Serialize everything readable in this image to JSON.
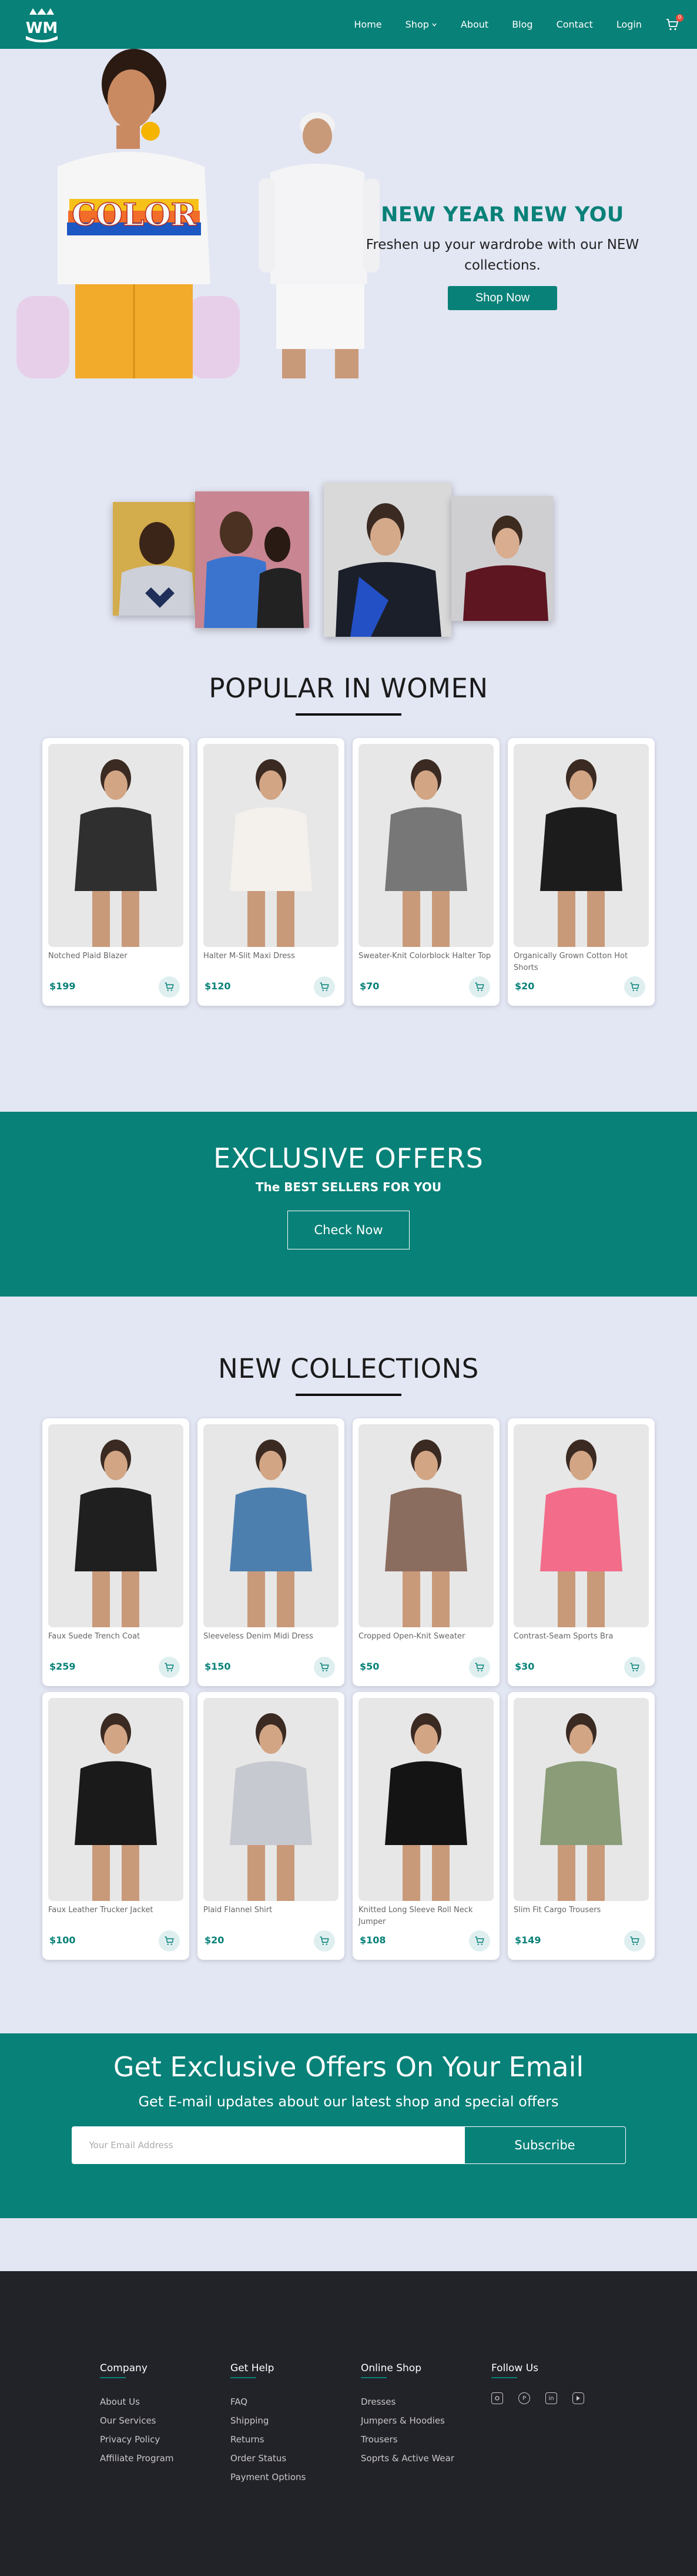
{
  "brand": {
    "logo_text": "WM",
    "accent_color": "#088178",
    "background_color": "#e3e6f3",
    "footer_color": "#222229"
  },
  "nav": {
    "items": [
      {
        "label": "Home"
      },
      {
        "label": "Shop"
      },
      {
        "label": "About"
      },
      {
        "label": "Blog"
      },
      {
        "label": "Contact"
      },
      {
        "label": "Login"
      }
    ],
    "cart_count": "0"
  },
  "hero": {
    "title": "NEW YEAR NEW YOU",
    "subtitle": "Freshen up your wardrobe with our NEW collections.",
    "button": "Shop Now",
    "shirt_text": "COLOR"
  },
  "popular": {
    "title": "POPULAR IN WOMEN",
    "products": [
      {
        "name": "Notched Plaid Blazer",
        "price": "$199",
        "tone": "#2f2f2f"
      },
      {
        "name": "Halter M-Slit Maxi Dress",
        "price": "$120",
        "tone": "#f4f1ec"
      },
      {
        "name": "Sweater-Knit Colorblock Halter Top",
        "price": "$70",
        "tone": "#777777"
      },
      {
        "name": "Organically Grown Cotton Hot Shorts",
        "price": "$20",
        "tone": "#1c1c1c"
      }
    ]
  },
  "offers": {
    "title": "EXCLUSIVE OFFERS",
    "subtitle": "The BEST SELLERS FOR YOU",
    "button": "Check Now"
  },
  "collections": {
    "title": "NEW COLLECTIONS",
    "products": [
      {
        "name": "Faux Suede Trench Coat",
        "price": "$259",
        "tone": "#1f1f1f"
      },
      {
        "name": "Sleeveless Denim Midi Dress",
        "price": "$150",
        "tone": "#4d7fae"
      },
      {
        "name": "Cropped Open-Knit Sweater",
        "price": "$50",
        "tone": "#8b6d60"
      },
      {
        "name": "Contrast-Seam Sports Bra",
        "price": "$30",
        "tone": "#f36c8a"
      },
      {
        "name": "Faux Leather Trucker Jacket",
        "price": "$100",
        "tone": "#1a1a1a"
      },
      {
        "name": "Plaid Flannel Shirt",
        "price": "$20",
        "tone": "#c7c9d0"
      },
      {
        "name": "Knitted Long Sleeve Roll Neck Jumper",
        "price": "$108",
        "tone": "#141414"
      },
      {
        "name": "Slim Fit Cargo Trousers",
        "price": "$149",
        "tone": "#8a9c78"
      }
    ]
  },
  "newsletter": {
    "title": "Get Exclusive Offers On Your Email",
    "subtitle": "Get E-mail updates about our latest shop and special offers",
    "placeholder": "Your Email Address",
    "button": "Subscribe"
  },
  "footer": {
    "columns": [
      {
        "title": "Company",
        "links": [
          "About Us",
          "Our Services",
          "Privacy Policy",
          "Affiliate Program"
        ]
      },
      {
        "title": "Get Help",
        "links": [
          "FAQ",
          "Shipping",
          "Returns",
          "Order Status",
          "Payment Options"
        ]
      },
      {
        "title": "Online Shop",
        "links": [
          "Dresses",
          "Jumpers & Hoodies",
          "Trousers",
          "Soprts & Active Wear"
        ]
      }
    ],
    "follow_title": "Follow Us",
    "socials": [
      "instagram-icon",
      "pinterest-icon",
      "linkedin-icon",
      "youtube-icon"
    ]
  }
}
